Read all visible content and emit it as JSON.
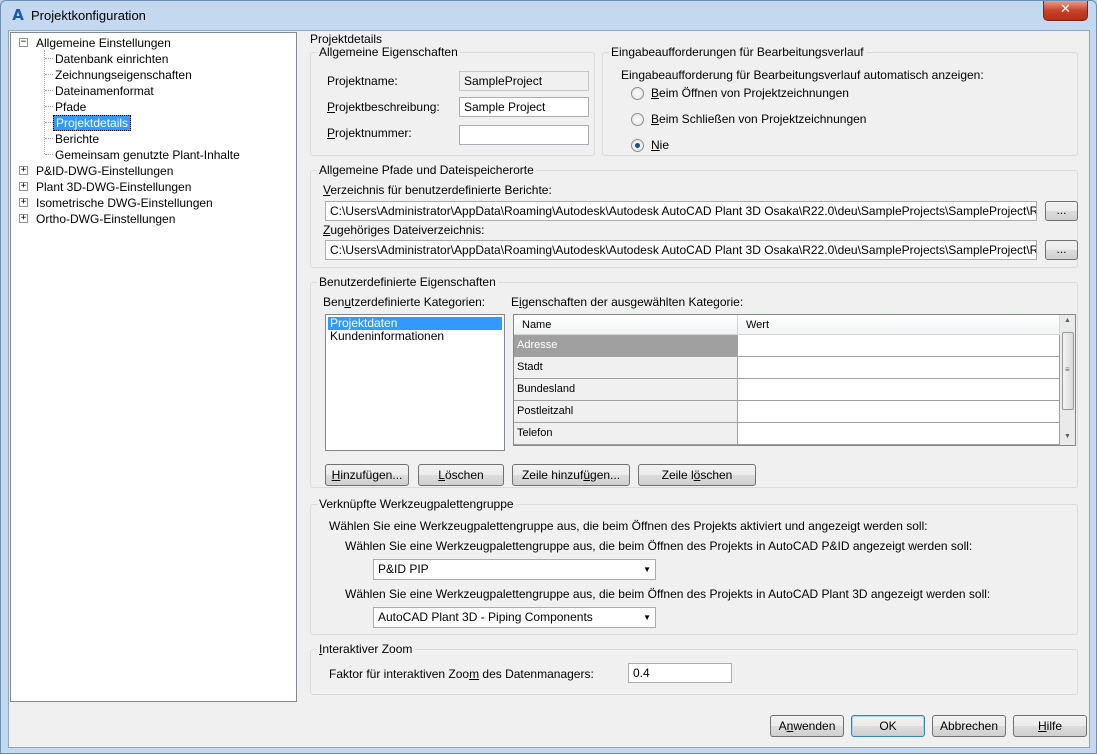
{
  "window": {
    "title": "Projektkonfiguration",
    "app_icon": "autocad-a-icon",
    "close_glyph": "✕"
  },
  "tree": {
    "root1": {
      "label": "Allgemeine Einstellungen",
      "expander": "−"
    },
    "children": [
      "Datenbank einrichten",
      "Zeichnungseigenschaften",
      "Dateinamenformat",
      "Pfade",
      "Projektdetails",
      "Berichte",
      "Gemeinsam genutzte Plant-Inhalte"
    ],
    "roots": [
      {
        "label": "P&ID-DWG-Einstellungen",
        "expander": "+"
      },
      {
        "label": "Plant 3D-DWG-Einstellungen",
        "expander": "+"
      },
      {
        "label": "Isometrische DWG-Einstellungen",
        "expander": "+"
      },
      {
        "label": "Ortho-DWG-Einstellungen",
        "expander": "+"
      }
    ]
  },
  "section_title": "Projektdetails",
  "general": {
    "title": "Allgemeine Eigenschaften",
    "name_label": "Projektname:",
    "name_value": "SampleProject",
    "desc_label_u": "P",
    "desc_label_rest": "rojektbeschreibung:",
    "desc_value": "Sample Project",
    "number_label_u": "P",
    "number_label_rest": "rojektnummer:",
    "number_value": ""
  },
  "prompts": {
    "title": "Eingabeaufforderungen für Bearbeitungsverlauf",
    "question": "Eingabeaufforderung für Bearbeitungsverlauf automatisch anzeigen:",
    "options": [
      {
        "u": "B",
        "rest": "eim Öffnen von Projektzeichnungen",
        "checked": false
      },
      {
        "u": "B",
        "rest": "eim Schließen von Projektzeichnungen",
        "checked": false
      },
      {
        "u": "N",
        "rest": "ie",
        "checked": true
      }
    ]
  },
  "paths": {
    "title": "Allgemeine Pfade und Dateispeicherorte",
    "reports_label_u": "V",
    "reports_label_rest": "erzeichnis für benutzerdefinierte Berichte:",
    "reports_value": "C:\\Users\\Administrator\\AppData\\Roaming\\Autodesk\\Autodesk AutoCAD Plant 3D Osaka\\R22.0\\deu\\SampleProjects\\SampleProject\\ReportTemp",
    "related_label_u": "Z",
    "related_label_rest": "ugehöriges Dateiverzeichnis:",
    "related_value": "C:\\Users\\Administrator\\AppData\\Roaming\\Autodesk\\Autodesk AutoCAD Plant 3D Osaka\\R22.0\\deu\\SampleProjects\\SampleProject\\Related_File",
    "browse_label": "..."
  },
  "custom": {
    "title": "Benutzerdefinierte Eigenschaften",
    "categories_label_pre": "Ben",
    "categories_label_u": "u",
    "categories_label_rest": "tzerdefinierte Kategorien:",
    "categories": [
      "Projektdaten",
      "Kundeninformationen"
    ],
    "props_label_pre": "E",
    "props_label_u": "i",
    "props_label_rest": "genschaften der ausgewählten Kategorie:",
    "columns": [
      "Name",
      "Wert"
    ],
    "rows": [
      {
        "name": "Adresse",
        "value": ""
      },
      {
        "name": "Stadt",
        "value": ""
      },
      {
        "name": "Bundesland",
        "value": ""
      },
      {
        "name": "Postleitzahl",
        "value": ""
      },
      {
        "name": "Telefon",
        "value": ""
      }
    ],
    "add_btn_u": "H",
    "add_btn_rest": "inzufügen...",
    "delete_btn_u": "L",
    "delete_btn_rest": "öschen",
    "addrow_btn_pre": "Zeile hinzuf",
    "addrow_btn_u": "ü",
    "addrow_btn_rest": "gen...",
    "delrow_btn_pre": "Zeile l",
    "delrow_btn_u": "ö",
    "delrow_btn_rest": "schen"
  },
  "palette": {
    "title": "Verknüpfte Werkzeugpalettengruppe",
    "intro": "Wählen Sie eine Werkzeugpalettengruppe aus, die beim Öffnen des Projekts aktiviert und angezeigt werden soll:",
    "pid_label": "Wählen Sie eine Werkzeugpalettengruppe aus, die beim Öffnen des Projekts in AutoCAD P&ID angezeigt werden soll:",
    "pid_value": "P&ID PIP",
    "p3d_label": "Wählen Sie eine Werkzeugpalettengruppe aus, die beim Öffnen des Projekts in AutoCAD Plant 3D angezeigt werden soll:",
    "p3d_value": "AutoCAD Plant 3D - Piping Components"
  },
  "zoom": {
    "title_u": "I",
    "title_rest": "nteraktiver Zoom",
    "label_pre": "Faktor für interaktiven Zoo",
    "label_u": "m",
    "label_rest": " des Datenmanagers:",
    "value": "0.4"
  },
  "footer": {
    "apply_pre": "A",
    "apply_u": "n",
    "apply_rest": "wenden",
    "ok": "OK",
    "cancel": "Abbrechen",
    "help_u": "H",
    "help_rest": "ilfe"
  }
}
